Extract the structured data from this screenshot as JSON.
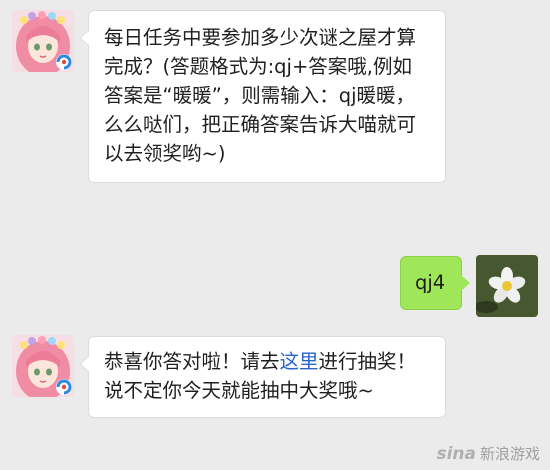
{
  "messages": [
    {
      "sender": "bot",
      "text": "每日任务中要参加多少次谜之屋才算完成？(答题格式为:qj+答案哦,例如答案是“暖暖”，则需输入：qj暖暖，么么哒们，把正确答案告诉大喵就可以去领奖哟~)"
    },
    {
      "sender": "user",
      "text": "qj4"
    },
    {
      "sender": "bot",
      "text_before": "恭喜你答对啦！请去",
      "link_text": "这里",
      "text_after": "进行抽奖！说不定你今天就能抽中大奖哦~"
    }
  ],
  "watermark": {
    "logo": "sina",
    "text": "新浪游戏"
  },
  "colors": {
    "background": "#ebebeb",
    "bot_bubble": "#ffffff",
    "user_bubble": "#9fe658",
    "link": "#2a64c8"
  },
  "icons": {
    "bot_avatar": "anime-girl-avatar-icon",
    "user_avatar": "white-flower-avatar-icon",
    "badge": "tencent-games-badge-icon"
  }
}
